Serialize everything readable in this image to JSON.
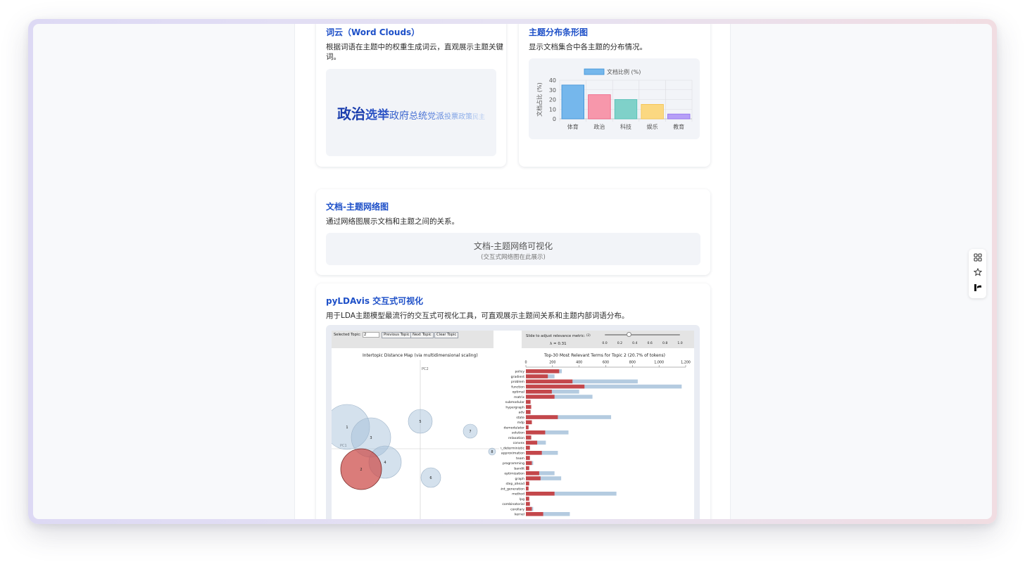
{
  "wordcloud_card": {
    "title": "词云（Word Clouds）",
    "desc_line1": "根据词语在主题中的权重生成词云，直观展示主题关键",
    "desc_line2": "词。",
    "words": [
      "政治",
      "选举",
      "政府",
      "总统",
      "党派",
      "投票",
      "政策",
      "民主"
    ]
  },
  "bar_card": {
    "title": "主题分布条形图",
    "desc": "显示文档集合中各主题的分布情况。"
  },
  "chart_data": {
    "type": "bar",
    "categories": [
      "体育",
      "政治",
      "科技",
      "娱乐",
      "教育"
    ],
    "series": [
      {
        "name": "文档比例 (%)",
        "values": [
          35,
          25,
          20,
          15,
          5
        ]
      }
    ],
    "colors": [
      "#75b7ec",
      "#f797ab",
      "#7fd1c9",
      "#fbd881",
      "#b69ff7"
    ],
    "ylabel": "文档占比 (%)",
    "yticks": [
      "0",
      "10",
      "20",
      "30",
      "40"
    ],
    "ylim": [
      0,
      40
    ],
    "grid": true,
    "legend": "top-center"
  },
  "network_card": {
    "title": "文档-主题网络图",
    "desc": "通过网络图展示文档和主题之间的关系。",
    "placeholder_title": "文档-主题网络可视化",
    "placeholder_sub": "(交互式网络图在此展示)"
  },
  "pyldavis_card": {
    "title": "pyLDAvis 交互式可视化",
    "desc": "用于LDA主题模型最流行的交互式可视化工具，可直观展示主题间关系和主题内部词语分布。",
    "selected_topic_label": "Selected Topic:",
    "selected_topic_value": "2",
    "prev_label": "Previous Topic",
    "next_label": "Next Topic",
    "clear_label": "Clear Topic",
    "slider_label": "Slide to adjust relevance metric:",
    "slider_footnote": "(2)",
    "lambda_label": "λ = 0.31",
    "slider_ticks": [
      "0.0",
      "0.2",
      "0.4",
      "0.6",
      "0.8",
      "1.0"
    ],
    "map_title": "Intertopic Distance Map (via multidimensional scaling)",
    "pc1": "PC1",
    "pc2": "PC2",
    "bars_title": "Top-30 Most Relevant Terms for Topic 2 (20.7% of tokens)",
    "axis_ticks": [
      "0",
      "200",
      "400",
      "600",
      "800",
      "1,000",
      "1,200"
    ],
    "topics": [
      {
        "label": "1"
      },
      {
        "label": "2"
      },
      {
        "label": "3"
      },
      {
        "label": "4"
      },
      {
        "label": "5"
      },
      {
        "label": "6"
      },
      {
        "label": "7"
      },
      {
        "label": "8"
      }
    ],
    "terms": [
      {
        "term": "policy",
        "topic": 250,
        "overall": 270
      },
      {
        "term": "gradient",
        "topic": 165,
        "overall": 215
      },
      {
        "term": "problem",
        "topic": 350,
        "overall": 840
      },
      {
        "term": "function",
        "topic": 440,
        "overall": 1170
      },
      {
        "term": "optimal",
        "topic": 195,
        "overall": 400
      },
      {
        "term": "matrix",
        "topic": 215,
        "overall": 500
      },
      {
        "term": "submodular",
        "topic": 35,
        "overall": 35
      },
      {
        "term": "hypergraph",
        "topic": 40,
        "overall": 40
      },
      {
        "term": "adv",
        "topic": 35,
        "overall": 35
      },
      {
        "term": "state",
        "topic": 240,
        "overall": 640
      },
      {
        "term": "mdp",
        "topic": 45,
        "overall": 45
      },
      {
        "term": "demodulator",
        "topic": 20,
        "overall": 20
      },
      {
        "term": "solution",
        "topic": 145,
        "overall": 320
      },
      {
        "term": "relaxation",
        "topic": 40,
        "overall": 40
      },
      {
        "term": "convex",
        "topic": 85,
        "overall": 150
      },
      {
        "term": "non_deterministic",
        "topic": 30,
        "overall": 30
      },
      {
        "term": "approximation",
        "topic": 120,
        "overall": 240
      },
      {
        "term": "team",
        "topic": 30,
        "overall": 30
      },
      {
        "term": "programming",
        "topic": 45,
        "overall": 55
      },
      {
        "term": "bandit",
        "topic": 25,
        "overall": 25
      },
      {
        "term": "optimization",
        "topic": 100,
        "overall": 215
      },
      {
        "term": "graph",
        "topic": 110,
        "overall": 265
      },
      {
        "term": "step_ahead",
        "topic": 25,
        "overall": 25
      },
      {
        "term": "constraint_generation",
        "topic": 20,
        "overall": 20
      },
      {
        "term": "method",
        "topic": 215,
        "overall": 680
      },
      {
        "term": "lpg",
        "topic": 25,
        "overall": 25
      },
      {
        "term": "combinatorial",
        "topic": 30,
        "overall": 30
      },
      {
        "term": "corollary",
        "topic": 45,
        "overall": 55
      },
      {
        "term": "kernel",
        "topic": 130,
        "overall": 330
      }
    ]
  },
  "side_toolbar": {
    "icons": [
      "grid-icon",
      "star-icon",
      "brand-icon"
    ]
  }
}
